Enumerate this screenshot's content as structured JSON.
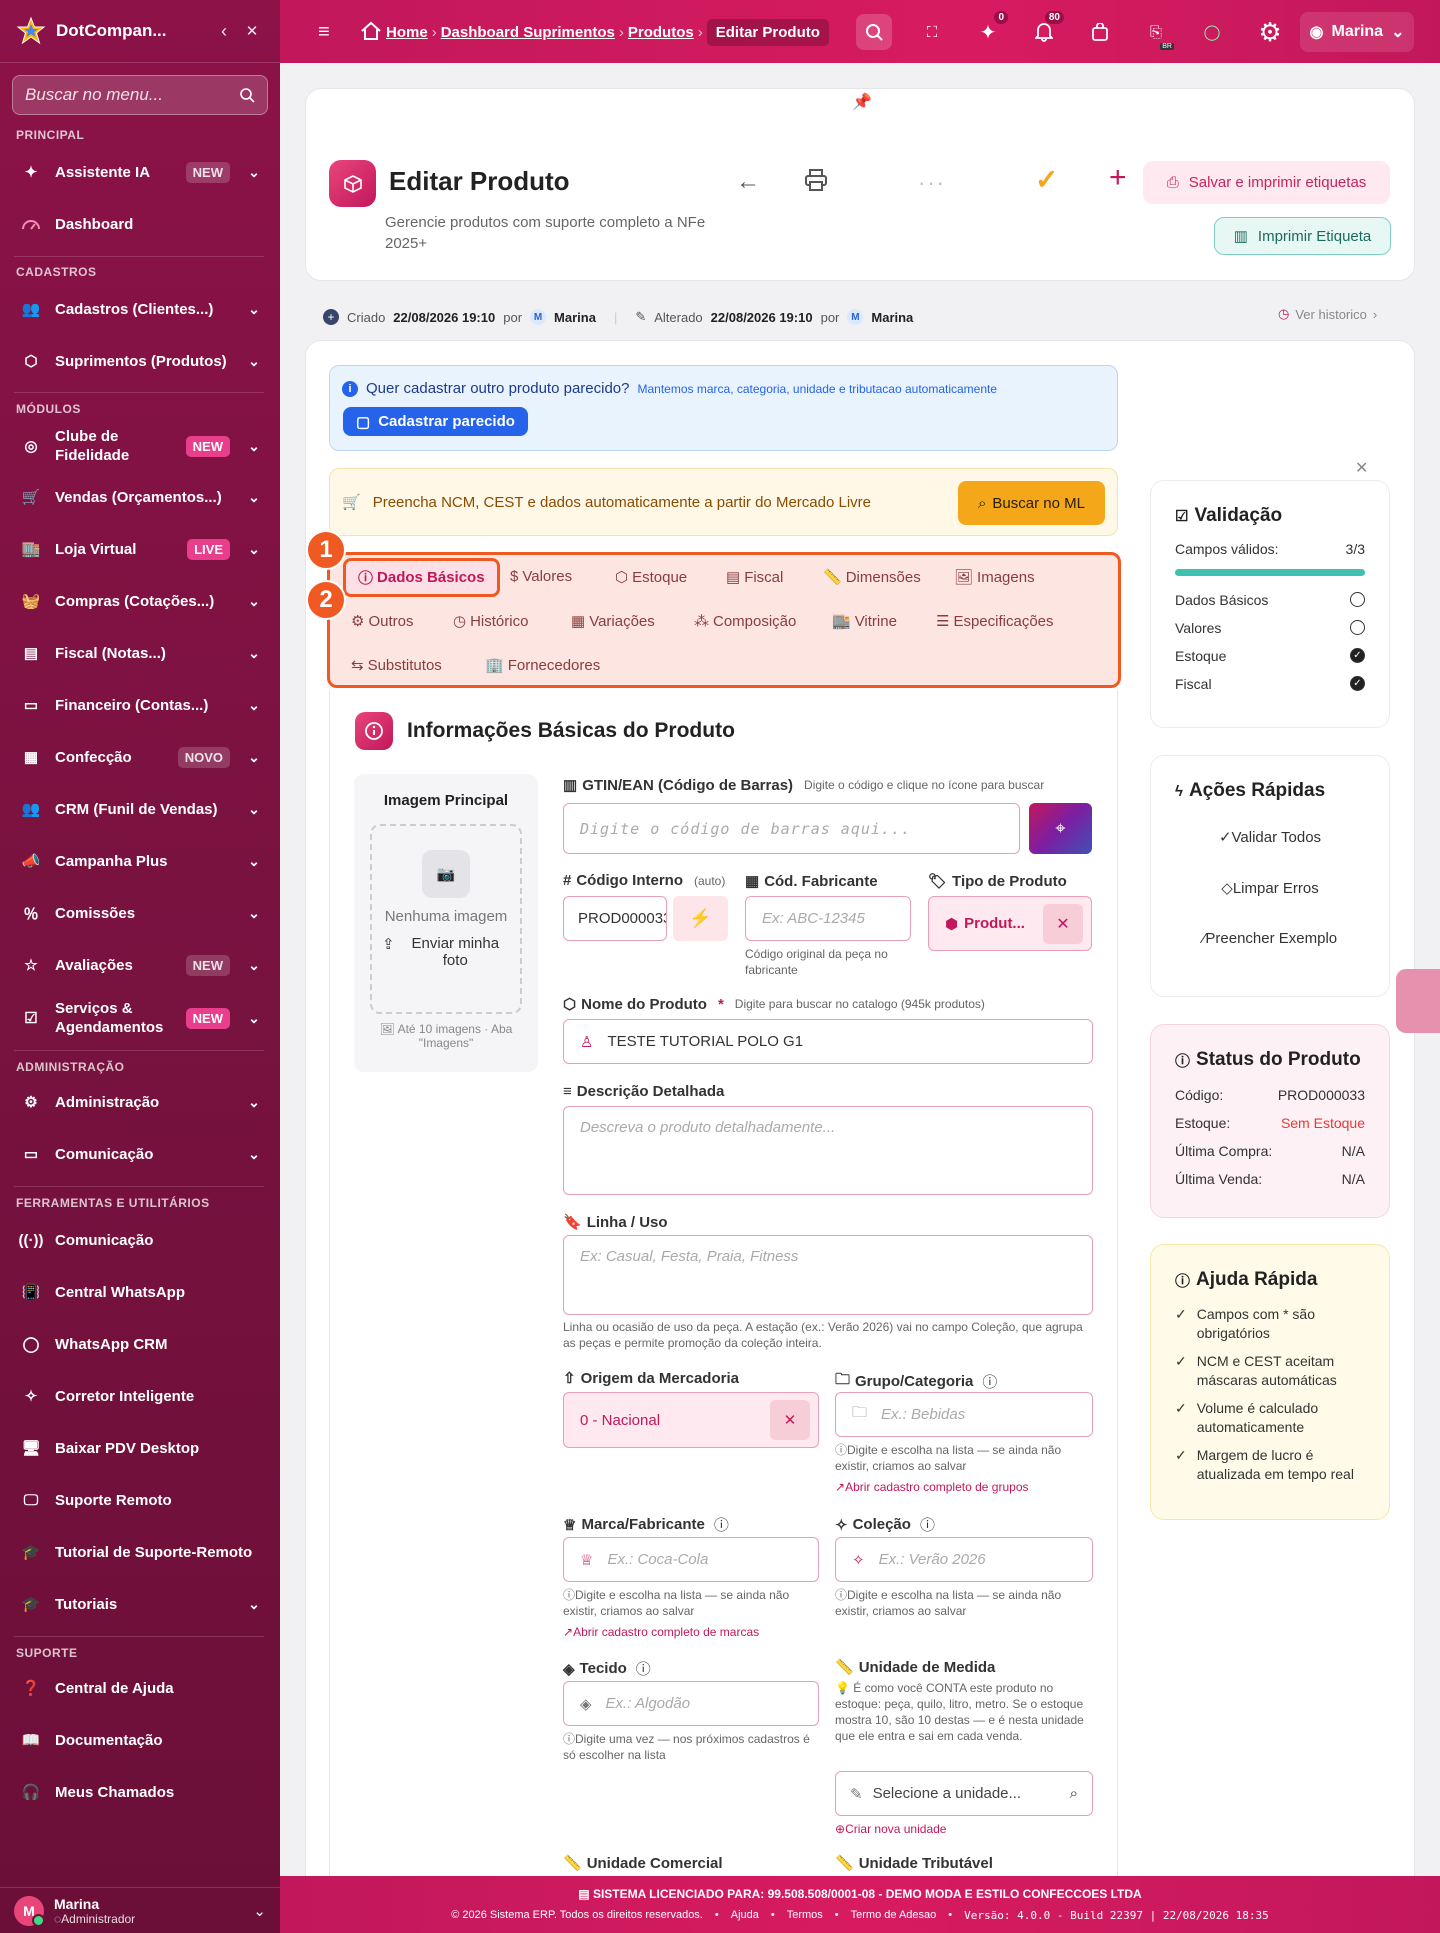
{
  "app": {
    "brand": "DotCompan..."
  },
  "sidebar": {
    "search_placeholder": "Buscar no menu...",
    "sections": {
      "principal": "PRINCIPAL",
      "cadastros": "CADASTROS",
      "modulos": "MÓDULOS",
      "admin": "ADMINISTRAÇÃO",
      "ferramentas": "FERRAMENTAS E UTILITÁRIOS",
      "suporte": "SUPORTE"
    },
    "items": [
      {
        "label": "Assistente IA",
        "badge": "NEW"
      },
      {
        "label": "Dashboard"
      },
      {
        "label": "Cadastros (Clientes...)"
      },
      {
        "label": "Suprimentos (Produtos)"
      },
      {
        "label": "Clube de Fidelidade",
        "badge": "NEW"
      },
      {
        "label": "Vendas (Orçamentos...)"
      },
      {
        "label": "Loja Virtual",
        "badge": "LIVE"
      },
      {
        "label": "Compras (Cotações...)"
      },
      {
        "label": "Fiscal (Notas...)"
      },
      {
        "label": "Financeiro (Contas...)"
      },
      {
        "label": "Confecção",
        "badge": "NOVO"
      },
      {
        "label": "CRM (Funil de Vendas)"
      },
      {
        "label": "Campanha Plus"
      },
      {
        "label": "Comissões"
      },
      {
        "label": "Avaliações",
        "badge": "NEW"
      },
      {
        "label": "Serviços & Agendamentos",
        "badge": "NEW"
      },
      {
        "label": "Administração"
      },
      {
        "label": "Comunicação"
      },
      {
        "label": "Comunicação"
      },
      {
        "label": "Central WhatsApp"
      },
      {
        "label": "WhatsApp CRM"
      },
      {
        "label": "Corretor Inteligente"
      },
      {
        "label": "Baixar PDV Desktop"
      },
      {
        "label": "Suporte Remoto"
      },
      {
        "label": "Tutorial de Suporte-Remoto"
      },
      {
        "label": "Tutoriais"
      },
      {
        "label": "Central de Ajuda"
      },
      {
        "label": "Documentação"
      },
      {
        "label": "Meus Chamados"
      }
    ],
    "user": {
      "initial": "M",
      "name": "Marina",
      "role": "Administrador"
    }
  },
  "topbar": {
    "breadcrumb": [
      "Home",
      "Dashboard Suprimentos",
      "Produtos"
    ],
    "current": "Editar Produto",
    "counts": {
      "ai": "0",
      "notifications": "80"
    },
    "flag": "BR",
    "user": "Marina"
  },
  "page": {
    "title": "Editar Produto",
    "subtitle": "Gerencie produtos com suporte completo a NFe 2025+",
    "save_print_label": "Salvar e imprimir etiquetas",
    "print_label": "Imprimir Etiqueta",
    "ellipsis": "···"
  },
  "meta": {
    "created_label": "Criado",
    "created": "22/08/2026 19:10",
    "por": "por",
    "user_initial": "M",
    "created_by": "Marina",
    "altered_label": "Alterado",
    "altered": "22/08/2026 19:10",
    "altered_by": "Marina",
    "history": "Ver historico"
  },
  "alerts": {
    "similar_q": "Quer cadastrar outro produto parecido?",
    "similar_hint": "Mantemos marca, categoria, unidade e tributacao automaticamente",
    "similar_btn": "Cadastrar parecido",
    "ml_text": "Preencha NCM, CEST e dados automaticamente a partir do Mercado Livre",
    "ml_btn": "Buscar no ML"
  },
  "tabs": [
    "Dados Básicos",
    "Valores",
    "Estoque",
    "Fiscal",
    "Dimensões",
    "Imagens",
    "Outros",
    "Histórico",
    "Variações",
    "Composição",
    "Vitrine",
    "Especificações",
    "Substitutos",
    "Fornecedores"
  ],
  "markers": [
    "1",
    "2"
  ],
  "form": {
    "section_title": "Informações Básicas do Produto",
    "image": {
      "title": "Imagem Principal",
      "empty": "Nenhuma imagem",
      "upload": "Enviar minha foto",
      "note": "Até 10 imagens · Aba \"Imagens\""
    },
    "gtin": {
      "label": "GTIN/EAN (Código de Barras)",
      "hint": "Digite o código e clique no ícone para buscar",
      "placeholder": "Digite o código de barras aqui..."
    },
    "cod_interno": {
      "label": "Código Interno",
      "hint": "(auto)",
      "value": "PROD000033"
    },
    "cod_fab": {
      "label": "Cód. Fabricante",
      "placeholder": "Ex: ABC-12345",
      "note": "Código original da peça no fabricante"
    },
    "tipo": {
      "label": "Tipo de Produto",
      "value": "Produt..."
    },
    "nome": {
      "label": "Nome do Produto",
      "required": "*",
      "hint": "Digite para buscar no catalogo (945k produtos)",
      "value": "TESTE TUTORIAL POLO G1"
    },
    "descricao": {
      "label": "Descrição Detalhada",
      "placeholder": "Descreva o produto detalhadamente..."
    },
    "linha": {
      "label": "Linha / Uso",
      "placeholder": "Ex: Casual, Festa, Praia, Fitness",
      "note": "Linha ou ocasião de uso da peça. A estação (ex.: Verão 2026) vai no campo Coleção, que agrupa as peças e permite promoção da coleção inteira."
    },
    "origem": {
      "label": "Origem da Mercadoria",
      "value": "0 - Nacional"
    },
    "grupo": {
      "label": "Grupo/Categoria",
      "placeholder": "Ex.: Bebidas",
      "note": "Digite e escolha na lista — se ainda não existir, criamos ao salvar",
      "link": "Abrir cadastro completo de grupos"
    },
    "marca": {
      "label": "Marca/Fabricante",
      "placeholder": "Ex.: Coca-Cola",
      "note": "Digite e escolha na lista — se ainda não existir, criamos ao salvar",
      "link": "Abrir cadastro completo de marcas"
    },
    "colecao": {
      "label": "Coleção",
      "placeholder": "Ex.: Verão 2026",
      "note": "Digite e escolha na lista — se ainda não existir, criamos ao salvar"
    },
    "tecido": {
      "label": "Tecido",
      "placeholder": "Ex.: Algodão",
      "note": "Digite uma vez — nos próximos cadastros é só escolher na lista"
    },
    "unidade": {
      "label": "Unidade de Medida",
      "note": "É como você CONTA este produto no estoque: peça, quilo, litro, metro. Se o estoque mostra 10, são 10 destas — e é nesta unidade que ele entra e sai em cada venda.",
      "placeholder": "Selecione a unidade...",
      "link": "Criar nova unidade"
    },
    "un_comercial": {
      "label": "Unidade Comercial"
    },
    "un_tributavel": {
      "label": "Unidade Tributável"
    }
  },
  "validation": {
    "title": "Validação",
    "valid_label": "Campos válidos:",
    "valid_value": "3/3",
    "progress": 1.0,
    "items": [
      {
        "label": "Dados Básicos",
        "ok": false
      },
      {
        "label": "Valores",
        "ok": false
      },
      {
        "label": "Estoque",
        "ok": true
      },
      {
        "label": "Fiscal",
        "ok": true
      }
    ]
  },
  "quick_actions": {
    "title": "Ações Rápidas",
    "items": [
      "Validar Todos",
      "Limpar Erros",
      "Preencher Exemplo"
    ]
  },
  "status": {
    "title": "Status do Produto",
    "rows": [
      {
        "label": "Código:",
        "value": "PROD000033"
      },
      {
        "label": "Estoque:",
        "value": "Sem Estoque"
      },
      {
        "label": "Última Compra:",
        "value": "N/A"
      },
      {
        "label": "Última Venda:",
        "value": "N/A"
      }
    ]
  },
  "help": {
    "title": "Ajuda Rápida",
    "items": [
      "Campos com * são obrigatórios",
      "NCM e CEST aceitam máscaras automáticas",
      "Volume é calculado automaticamente",
      "Margem de lucro é atualizada em tempo real"
    ]
  },
  "footer": {
    "license": "SISTEMA LICENCIADO PARA: 99.508.508/0001-08 - DEMO MODA E ESTILO CONFECCOES LTDA",
    "copyright": "© 2026 Sistema ERP. Todos os direitos reservados.",
    "ajuda": "Ajuda",
    "termos": "Termos",
    "adesao": "Termo de Adesao",
    "version": "Versão: 4.0.0 - Build 22397 | 22/08/2026 18:35"
  },
  "colors": {
    "sidebar": "#7a1240",
    "topbar": "#d81b60",
    "accent": "#c2185b",
    "highlight": "#f05a22"
  }
}
